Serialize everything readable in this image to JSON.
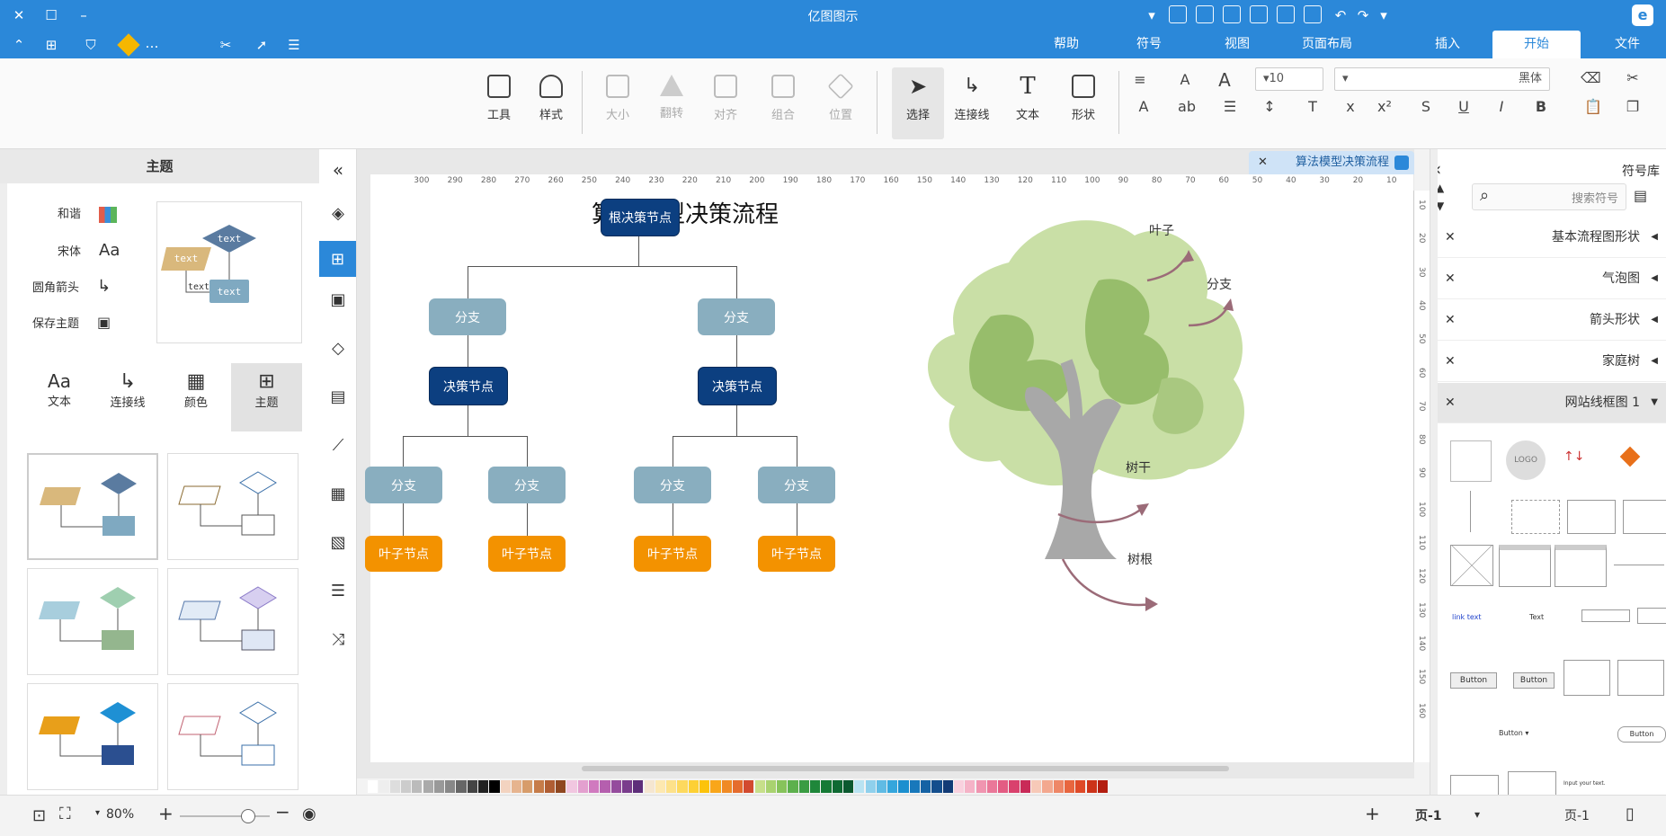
{
  "app": {
    "title": "亿图图示"
  },
  "menu": {
    "tabs": [
      "文件",
      "开始",
      "插入",
      "页面布局",
      "视图",
      "符号",
      "帮助"
    ],
    "active_index": 1
  },
  "ribbon": {
    "font_name": "黑体",
    "font_size": "10",
    "tools": [
      "形状",
      "文本",
      "连接线",
      "选择",
      "位置",
      "组合",
      "对齐",
      "翻转",
      "大小",
      "样式",
      "工具"
    ],
    "selected_tool": "选择"
  },
  "left_panel": {
    "title": "主题",
    "options": [
      "和谐",
      "宋体",
      "圆角箭头",
      "保存主题"
    ],
    "tabs": [
      "主题",
      "颜色",
      "连接线",
      "文本"
    ],
    "active_tab": "主题",
    "sample_text": "text"
  },
  "document_tab": {
    "name": "算法模型决策流程"
  },
  "ruler": {
    "h_ticks": [
      "10",
      "20",
      "30",
      "40",
      "50",
      "60",
      "70",
      "80",
      "90",
      "100",
      "110",
      "120",
      "130",
      "140",
      "150",
      "160",
      "170",
      "180",
      "190",
      "200",
      "210",
      "220",
      "230",
      "240",
      "250",
      "260",
      "270",
      "280",
      "290",
      "300"
    ],
    "v_ticks": [
      "10",
      "20",
      "30",
      "40",
      "50",
      "60",
      "70",
      "80",
      "90",
      "100",
      "110",
      "120",
      "130",
      "140",
      "150",
      "160"
    ]
  },
  "diagram": {
    "title": "算法模型决策流程",
    "root": "根决策节点",
    "branch": "分支",
    "decision": "决策节点",
    "leaf": "叶子节点",
    "tree_labels": {
      "leaf": "叶子",
      "branch": "分支",
      "trunk": "树干",
      "root": "树根"
    }
  },
  "right_panel": {
    "title": "符号库",
    "search_placeholder": "搜索符号",
    "libraries": [
      "基本流程图形状",
      "气泡图",
      "箭头形状",
      "家庭树",
      "网站线框图 1"
    ],
    "wire_labels": {
      "logo": "LOGO",
      "button": "Button",
      "text": "Text",
      "input": "Input your text."
    }
  },
  "status": {
    "zoom": "80%",
    "page_label": "页-1",
    "page_tab": "页-1"
  },
  "colors": {
    "accent": "#2b88d9",
    "node_dark": "#0c3f80",
    "node_mid": "#89aebf",
    "node_leaf": "#f39200"
  }
}
